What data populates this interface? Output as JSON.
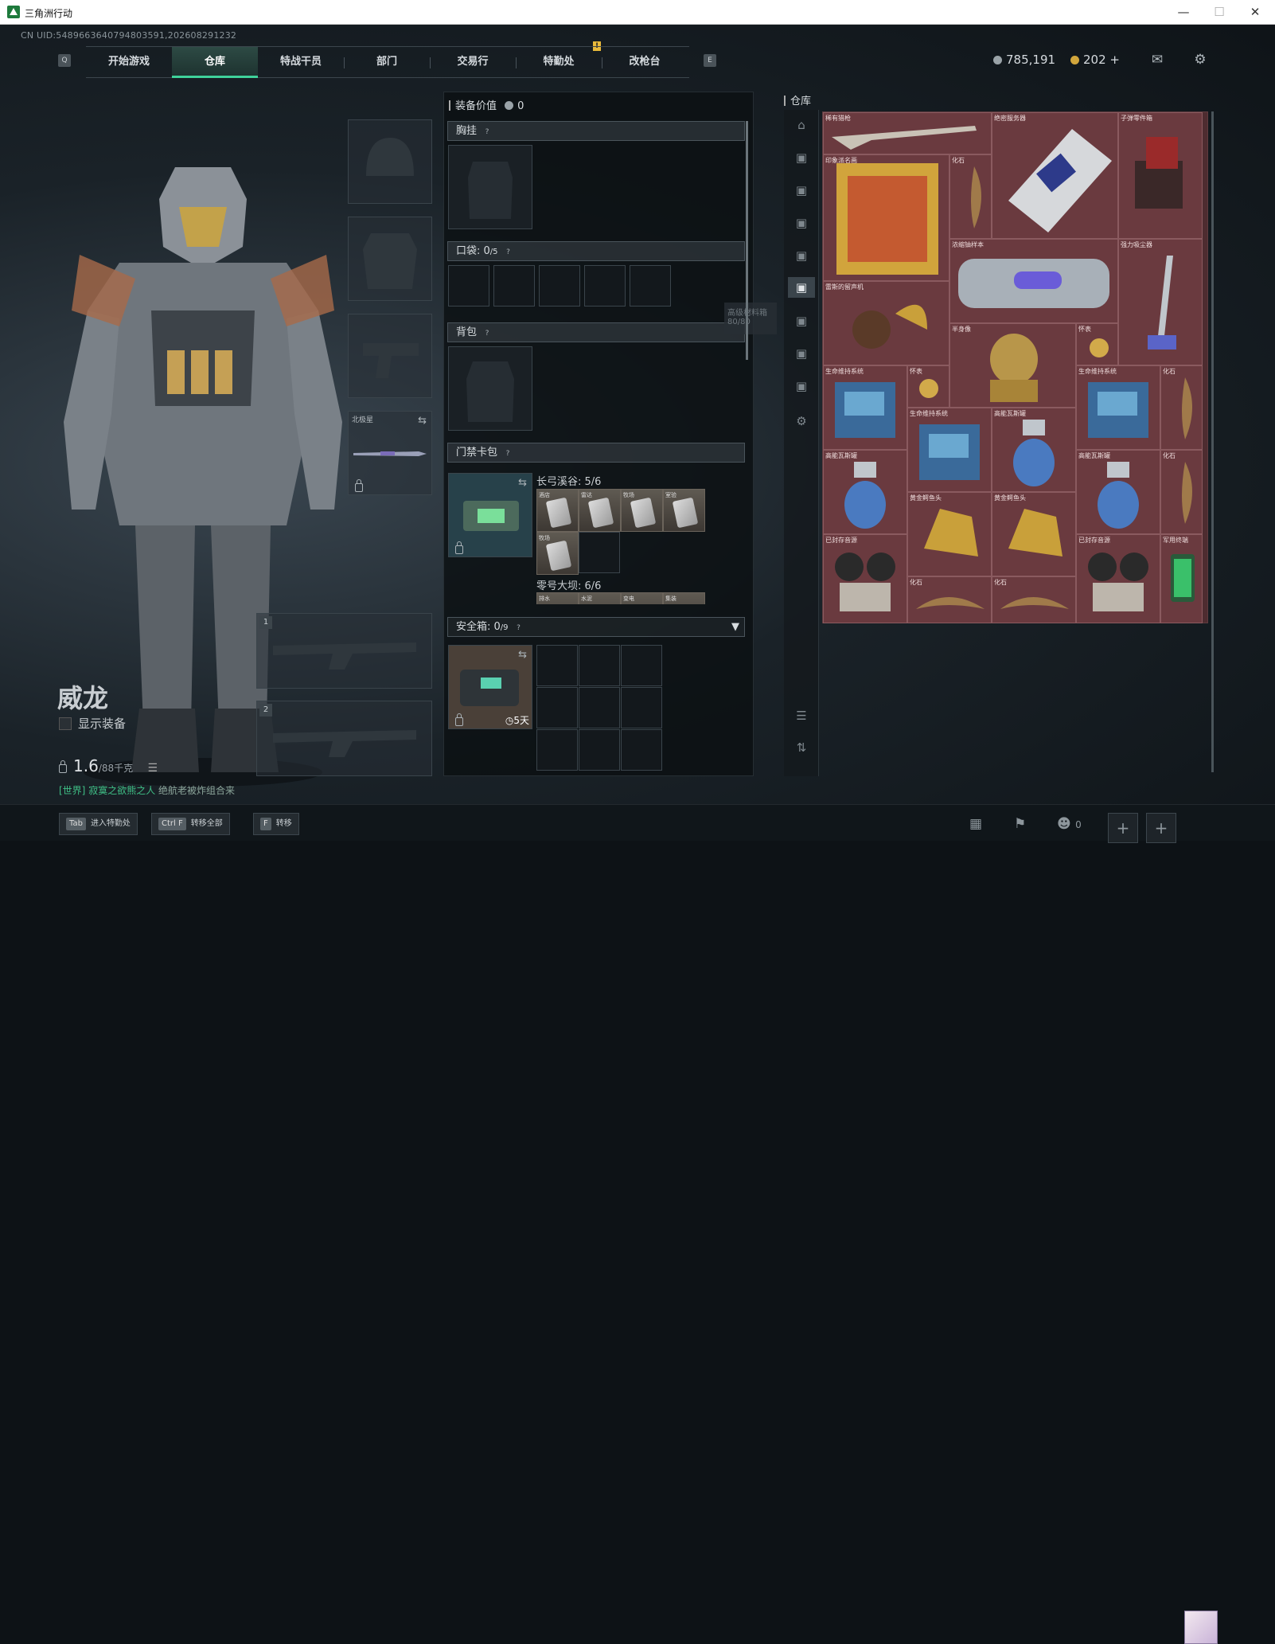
{
  "window": {
    "title": "三角洲行动"
  },
  "uid": "CN UID:5489663640794803591,202608291232",
  "nav": {
    "left_key": "Q",
    "right_key": "E",
    "tabs": [
      {
        "label": "开始游戏"
      },
      {
        "label": "仓库",
        "active": true
      },
      {
        "label": "特战干员"
      },
      {
        "label": "部门"
      },
      {
        "label": "交易行"
      },
      {
        "label": "特勤处"
      },
      {
        "label": "改枪台"
      }
    ],
    "badge": "!"
  },
  "currency": {
    "havoc_coin": "785,191",
    "gold_coin": "202",
    "plus": "+"
  },
  "icons": {
    "mail": "mail-icon",
    "settings": "gear-icon"
  },
  "operator": {
    "name": "威龙",
    "show_equipment": "显示装备",
    "weight": "1.6",
    "weight_max": "/88千克",
    "world_tag": "[世界]",
    "world_name": "寂寞之欲熊之人",
    "world_msg": " 绝航老被炸组合来"
  },
  "loadout": {
    "backup_weapon_label": "北极星",
    "slot1": "1",
    "slot2": "2"
  },
  "equipment": {
    "value_label": "装备价值",
    "value": "0",
    "chest_rig": "胸挂",
    "pockets": "口袋: ",
    "pockets_count": "0",
    "pockets_max": "/5",
    "backpack": "背包",
    "keycard_case": "门禁卡包",
    "changgong": "长弓溪谷: 5/6",
    "linghao": "零号大坝: 6/6",
    "safebox": "安全箱: ",
    "safebox_count": "0",
    "safebox_max": "/9",
    "safebox_days": "5天",
    "tooltip_line1": "高级材料箱",
    "tooltip_line2": "80/80",
    "keycards": [
      "酒店",
      "雷达",
      "牧场",
      "室验",
      "牧场"
    ],
    "keycards2": [
      "排水",
      "水泥",
      "变电",
      "集装"
    ]
  },
  "stash": {
    "title": "仓库",
    "items": [
      {
        "label": "稀有猎枪"
      },
      {
        "label": "绝密服务器"
      },
      {
        "label": "子弹零件箱"
      },
      {
        "label": "印象派名画"
      },
      {
        "label": "化石"
      },
      {
        "label": "浓缩铀样本"
      },
      {
        "label": "强力吸尘器"
      },
      {
        "label": "雷斯的留声机"
      },
      {
        "label": "半身像"
      },
      {
        "label": "怀表"
      },
      {
        "label": "生命维持系统"
      },
      {
        "label": "怀表"
      },
      {
        "label": "生命维持系统"
      },
      {
        "label": "化石"
      },
      {
        "label": "生命维持系统"
      },
      {
        "label": "高能瓦斯罐"
      },
      {
        "label": "高能瓦斯罐"
      },
      {
        "label": "高能瓦斯罐"
      },
      {
        "label": "化石"
      },
      {
        "label": "黄金鳄鱼头"
      },
      {
        "label": "黄金鳄鱼头"
      },
      {
        "label": "已封存音源"
      },
      {
        "label": "已封存音源"
      },
      {
        "label": "军用终端"
      },
      {
        "label": "化石"
      },
      {
        "label": "化石"
      }
    ]
  },
  "bottom": {
    "tab_key": "Tab",
    "tab_label": "进入特勤处",
    "ctrl_key": "Ctrl F",
    "ctrl_label": "转移全部",
    "f_key": "F",
    "f_label": "转移",
    "friends": "0"
  },
  "colors": {
    "accent": "#3fd29a",
    "stash_bg": "#4e2c30"
  }
}
